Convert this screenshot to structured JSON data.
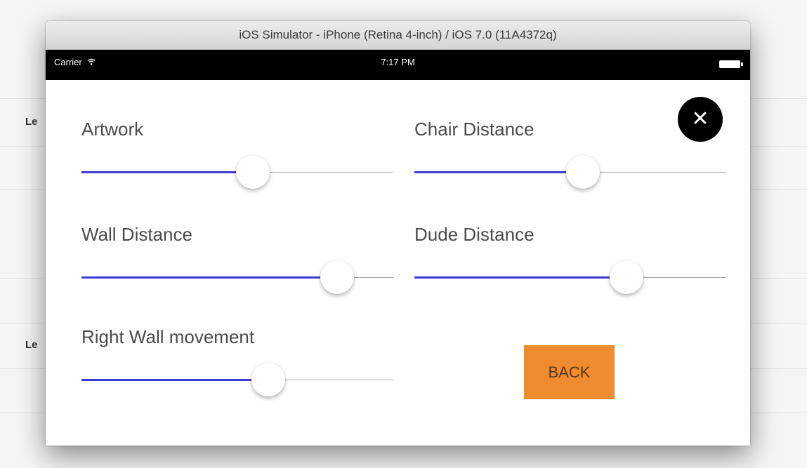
{
  "background": {
    "row_label_1": "Le",
    "row_label_2": "Le"
  },
  "window": {
    "title": "iOS Simulator - iPhone (Retina 4-inch) / iOS 7.0 (11A4372q)"
  },
  "status_bar": {
    "carrier": "Carrier",
    "wifi_icon": "wifi-icon",
    "time": "7:17 PM",
    "battery_icon": "battery-icon"
  },
  "close_button": {
    "icon": "close-icon",
    "glyph": "✕"
  },
  "sliders": [
    {
      "label": "Artwork",
      "value": 0.55
    },
    {
      "label": "Chair Distance",
      "value": 0.54
    },
    {
      "label": "Wall Distance",
      "value": 0.82
    },
    {
      "label": "Dude Distance",
      "value": 0.68
    },
    {
      "label": "Right Wall movement",
      "value": 0.6
    }
  ],
  "back_button": {
    "label": "BACK"
  },
  "colors": {
    "slider_fill": "#3d3bd6",
    "back_button": "#ef8c2f",
    "close_button": "#000000"
  }
}
